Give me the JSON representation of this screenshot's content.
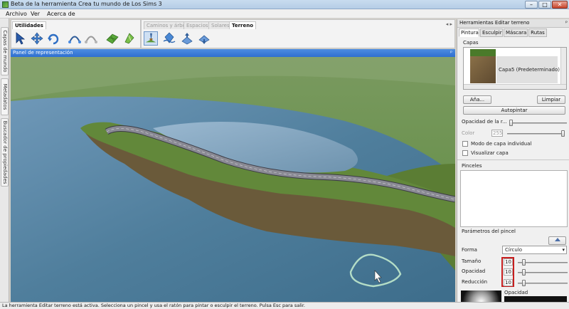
{
  "window": {
    "title": "Beta de la herramienta Crea tu mundo de Los Sims 3",
    "minimize_glyph": "–",
    "maximize_glyph": "□",
    "close_glyph": "✕"
  },
  "menu": [
    "Archivo",
    "Ver",
    "Acerca de"
  ],
  "left_tabs": [
    "Capas de mundo",
    "Metadatos",
    "Buscador de propiedades"
  ],
  "toolbar": {
    "utilities_tab": "Utilidades",
    "terrain_tabs": [
      "Caminos y árboles",
      "Espacios",
      "Solares",
      "Terreno"
    ],
    "active_terrain_tab": "Terreno",
    "scroll_arrows": "◂ ▸"
  },
  "viewport": {
    "title": "Panel de representación",
    "pin_glyph": "ᵖ"
  },
  "right_panel": {
    "title": "Herramientas Editar terreno",
    "pin_glyph": "ᵖ",
    "tabs": [
      "Pintura",
      "Esculpir",
      "Máscara",
      "Rutas"
    ],
    "active_tab": "Pintura",
    "layers_label": "Capas",
    "layer_item": "Capa5 (Predeterminado)",
    "add_button": "Aña...",
    "clear_button": "Limpiar",
    "autopaint_button": "Autopintar",
    "layer_opacity_label": "Opacidad de la r...",
    "color_label": "Color",
    "color_value": "255",
    "individual_layer_label": "Modo de capa individual",
    "visualize_layer_label": "Visualizar capa",
    "brushes_label": "Pinceles",
    "brush_params_label": "Parámetros del pincel",
    "shape_label": "Forma",
    "shape_value": "Círculo",
    "size_label": "Tamaño",
    "size_value": "10",
    "opacity_label": "Opacidad",
    "opacity_value": "10",
    "reduction_label": "Reducción",
    "reduction_value": "10",
    "bottom_opacity_label": "Opacidad"
  },
  "status": "La herramienta Editar terreno está activa. Selecciona un pincel y usa el ratón para pintar o esculpir el terreno. Pulsa Esc para salir.",
  "colors": {
    "water": "#4f7e9c",
    "grass": "#587a2c",
    "road": "#8a8a94",
    "highlight_box": "#c81e1e",
    "panel_header": "#3a7bd8"
  }
}
